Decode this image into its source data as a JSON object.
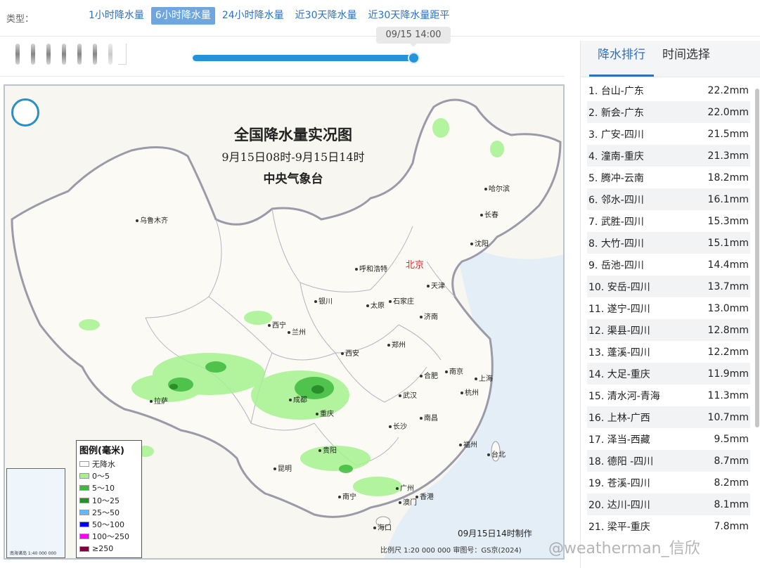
{
  "typebar": {
    "label": "类型：",
    "tabs": [
      "1小时降水量",
      "6小时降水量",
      "24小时降水量",
      "近30天降水量",
      "近30天降水量距平"
    ],
    "active_index": 1
  },
  "slider": {
    "time_tooltip": "09/15 14:00",
    "progress": 1.0
  },
  "map": {
    "title": "全国降水量实况图",
    "subtitle": "9月15日08时-9月15日14时",
    "organization": "中央气象台",
    "made_at": "09月15日14时制作",
    "scale_note": "比例尺 1:20 000 000   审图号：GS京(2024)",
    "legend": {
      "title": "图例(毫米)",
      "items": [
        {
          "label": "无降水",
          "color": "#ffffff"
        },
        {
          "label": "0～5",
          "color": "#a6f28f"
        },
        {
          "label": "5～10",
          "color": "#3dba3d"
        },
        {
          "label": "10～25",
          "color": "#2a8f2a"
        },
        {
          "label": "25～50",
          "color": "#61b8ff"
        },
        {
          "label": "50～100",
          "color": "#0000ff"
        },
        {
          "label": "100～250",
          "color": "#fa00fa"
        },
        {
          "label": "≥250",
          "color": "#800040"
        }
      ]
    },
    "cities": [
      {
        "name": "乌鲁木齐"
      },
      {
        "name": "哈尔滨"
      },
      {
        "name": "长春"
      },
      {
        "name": "沈阳"
      },
      {
        "name": "呼和浩特"
      },
      {
        "name": "北京"
      },
      {
        "name": "天津"
      },
      {
        "name": "银川"
      },
      {
        "name": "太原"
      },
      {
        "name": "石家庄"
      },
      {
        "name": "济南"
      },
      {
        "name": "西宁"
      },
      {
        "name": "兰州"
      },
      {
        "name": "西安"
      },
      {
        "name": "郑州"
      },
      {
        "name": "合肥"
      },
      {
        "name": "南京"
      },
      {
        "name": "上海"
      },
      {
        "name": "杭州"
      },
      {
        "name": "拉萨"
      },
      {
        "name": "成都"
      },
      {
        "name": "重庆"
      },
      {
        "name": "武汉"
      },
      {
        "name": "长沙"
      },
      {
        "name": "南昌"
      },
      {
        "name": "福州"
      },
      {
        "name": "台北"
      },
      {
        "name": "贵阳"
      },
      {
        "name": "昆明"
      },
      {
        "name": "南宁"
      },
      {
        "name": "广州"
      },
      {
        "name": "香港"
      },
      {
        "name": "澳门"
      },
      {
        "name": "海口"
      }
    ],
    "inset_label": "南海诸岛  1:40 000 000"
  },
  "watermark": "@weatherman_信欣",
  "panel": {
    "tabs": [
      "降水排行",
      "时间选择"
    ],
    "active_index": 0,
    "ranking": [
      {
        "rank": "1.",
        "station": "台山-广东",
        "value": "22.2mm"
      },
      {
        "rank": "2.",
        "station": "新会-广东",
        "value": "22.0mm"
      },
      {
        "rank": "3.",
        "station": "广安-四川",
        "value": "21.5mm"
      },
      {
        "rank": "4.",
        "station": "潼南-重庆",
        "value": "21.3mm"
      },
      {
        "rank": "5.",
        "station": "腾冲-云南",
        "value": "18.2mm"
      },
      {
        "rank": "6.",
        "station": "邻水-四川",
        "value": "16.1mm"
      },
      {
        "rank": "7.",
        "station": "武胜-四川",
        "value": "15.3mm"
      },
      {
        "rank": "8.",
        "station": "大竹-四川",
        "value": "15.1mm"
      },
      {
        "rank": "9.",
        "station": "岳池-四川",
        "value": "14.4mm"
      },
      {
        "rank": "10.",
        "station": "安岳-四川",
        "value": "13.7mm"
      },
      {
        "rank": "11.",
        "station": "遂宁-四川",
        "value": "13.0mm"
      },
      {
        "rank": "12.",
        "station": "渠县-四川",
        "value": "12.8mm"
      },
      {
        "rank": "13.",
        "station": "蓬溪-四川",
        "value": "12.2mm"
      },
      {
        "rank": "14.",
        "station": "大足-重庆",
        "value": "11.9mm"
      },
      {
        "rank": "15.",
        "station": "清水河-青海",
        "value": "11.3mm"
      },
      {
        "rank": "16.",
        "station": "上林-广西",
        "value": "10.7mm"
      },
      {
        "rank": "17.",
        "station": "泽当-西藏",
        "value": "9.5mm"
      },
      {
        "rank": "18.",
        "station": "德阳 -四川",
        "value": "8.7mm"
      },
      {
        "rank": "19.",
        "station": "苍溪-四川",
        "value": "8.2mm"
      },
      {
        "rank": "20.",
        "station": "达川-四川",
        "value": "8.1mm"
      },
      {
        "rank": "21.",
        "station": "梁平-重庆",
        "value": "7.8mm"
      }
    ]
  }
}
